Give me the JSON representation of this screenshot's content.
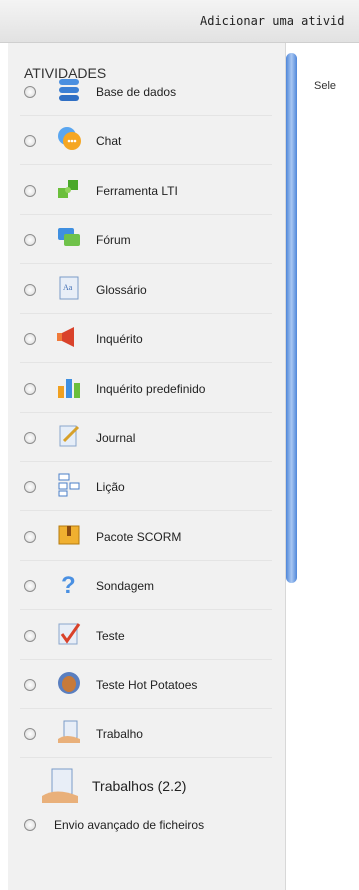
{
  "header": {
    "title": "Adicionar uma ativid"
  },
  "sidebar": {
    "title": "ATIVIDADES",
    "items": [
      {
        "label": "Base de dados"
      },
      {
        "label": "Chat"
      },
      {
        "label": "Ferramenta LTI"
      },
      {
        "label": "Fórum"
      },
      {
        "label": "Glossário"
      },
      {
        "label": "Inquérito"
      },
      {
        "label": "Inquérito predefinido"
      },
      {
        "label": "Journal"
      },
      {
        "label": "Lição"
      },
      {
        "label": "Pacote SCORM"
      },
      {
        "label": "Sondagem"
      },
      {
        "label": "Teste"
      },
      {
        "label": "Teste Hot Potatoes"
      },
      {
        "label": "Trabalho"
      }
    ],
    "group": {
      "label": "Trabalhos (2.2)"
    },
    "suboption": {
      "label": "Envio avançado de ficheiros"
    }
  },
  "main": {
    "text": "Sele"
  }
}
